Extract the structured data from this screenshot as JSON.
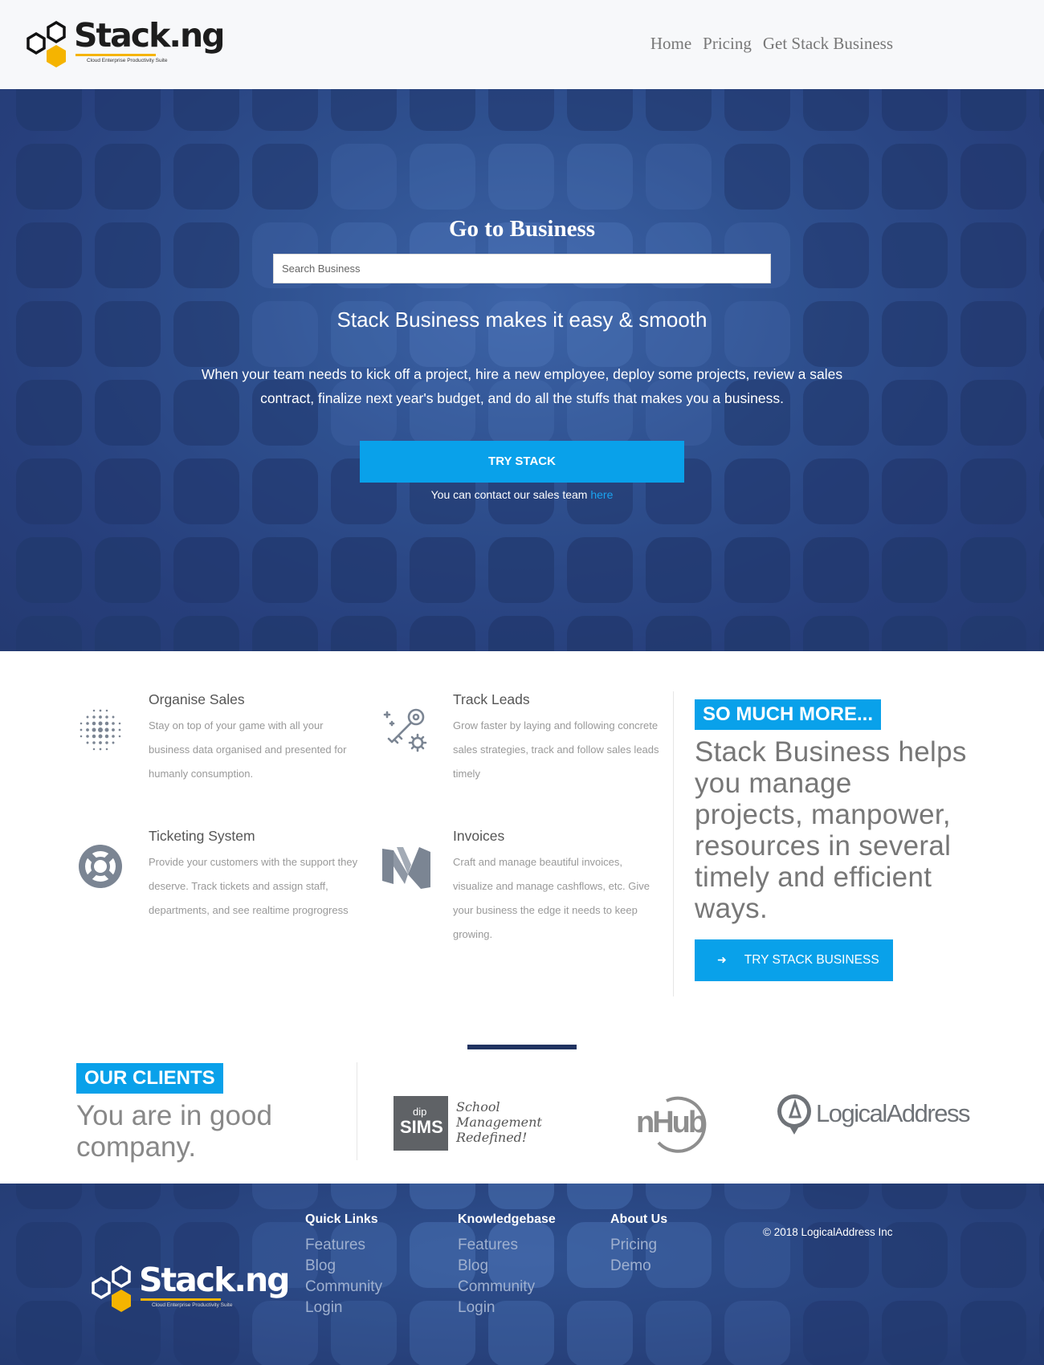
{
  "brand": {
    "name": "Stack.ng",
    "tagline": "Cloud Enterprise Productivity Suite"
  },
  "nav": {
    "items": [
      {
        "label": "Home"
      },
      {
        "label": "Pricing"
      },
      {
        "label": "Get Stack Business"
      }
    ]
  },
  "hero": {
    "title": "Go to Business",
    "search_placeholder": "Search Business",
    "subtitle": "Stack Business makes it easy & smooth",
    "body": "When your team needs to kick off a project, hire a new employee, deploy some projects, review a sales contract, finalize next year's budget, and do all the stuffs that makes you a business.",
    "cta_label": "TRY STACK",
    "contact_text": "You can contact our sales team ",
    "contact_link": "here"
  },
  "features": [
    {
      "title": "Organise Sales",
      "text": "Stay on top of your game with all your business data organised and presented for humanly consumption.",
      "icon": "dots-grid-icon"
    },
    {
      "title": "Track Leads",
      "text": "Grow faster by laying and following concrete sales strategies, track and follow sales leads timely",
      "icon": "key-gear-icon"
    },
    {
      "title": "Ticketing System",
      "text": "Provide your customers with the support they deserve. Track tickets and assign staff, departments, and see realtime progrogress",
      "icon": "lifebuoy-icon"
    },
    {
      "title": "Invoices",
      "text": "Craft and manage beautiful invoices, visualize and manage cashflows, etc. Give your business the edge it needs to keep growing.",
      "icon": "medium-m-icon"
    }
  ],
  "more": {
    "badge": "SO MUCH MORE...",
    "text": "Stack Business helps you manage projects, manpower, resources in several timely and efficient ways.",
    "cta_label": "TRY STACK BUSINESS",
    "cta_icon": "arrow-right-icon"
  },
  "clients": {
    "badge": "OUR CLIENTS",
    "tagline": "You are in good company.",
    "logos": [
      {
        "name": "dipSIMS",
        "small": "dip",
        "big": "SIMS",
        "caption": [
          "School",
          "Management",
          "Redefined!"
        ]
      },
      {
        "name": "nHub",
        "text": "nHub"
      },
      {
        "name": "LogicalAddress",
        "text": "LogicalAddress"
      }
    ]
  },
  "footer": {
    "columns": [
      {
        "title": "Quick Links",
        "links": [
          "Features",
          "Blog",
          "Community",
          "Login"
        ]
      },
      {
        "title": "Knowledgebase",
        "links": [
          "Features",
          "Blog",
          "Community",
          "Login"
        ]
      },
      {
        "title": "About Us",
        "links": [
          "Pricing",
          "Demo"
        ]
      }
    ],
    "copyright": "© 2018 LogicalAddress Inc"
  },
  "colors": {
    "accent": "#09a1ea",
    "hero_bg": "#2f5190",
    "brand_yellow": "#f5b400",
    "footer_rule": "#203361"
  }
}
